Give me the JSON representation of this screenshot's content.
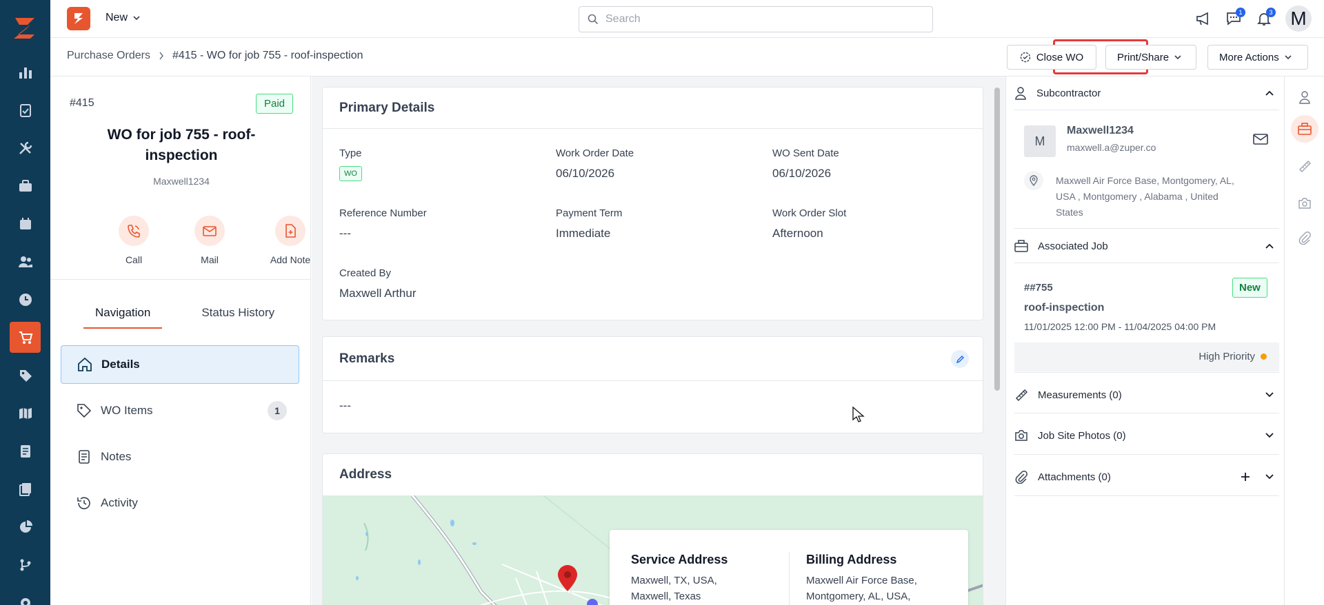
{
  "topbar": {
    "new_label": "New",
    "search_placeholder": "Search",
    "chat_badge": "1",
    "notif_badge": "3",
    "avatar_letter": "M"
  },
  "breadcrumb": {
    "root": "Purchase Orders",
    "current": "#415 - WO for job 755 - roof-inspection"
  },
  "actions": {
    "close_wo": "Close WO",
    "print_share": "Print/Share",
    "more_actions": "More Actions"
  },
  "wo": {
    "number": "#415",
    "status": "Paid",
    "title": "WO for job 755 - roof-inspection",
    "subtitle": "Maxwell1234",
    "quick_actions": [
      "Call",
      "Mail",
      "Add Note"
    ]
  },
  "tabs": [
    "Navigation",
    "Status History"
  ],
  "nav": [
    {
      "label": "Details",
      "icon": "home-icon"
    },
    {
      "label": "WO Items",
      "icon": "tag-icon",
      "count": "1"
    },
    {
      "label": "Notes",
      "icon": "note-icon"
    },
    {
      "label": "Activity",
      "icon": "history-icon"
    }
  ],
  "primary": {
    "title": "Primary Details",
    "type_label": "Type",
    "type_value": "WO",
    "wo_date_label": "Work Order Date",
    "wo_date_value": "06/10/2026",
    "sent_date_label": "WO Sent Date",
    "sent_date_value": "06/10/2026",
    "ref_label": "Reference Number",
    "ref_value": "---",
    "payment_label": "Payment Term",
    "payment_value": "Immediate",
    "slot_label": "Work Order Slot",
    "slot_value": "Afternoon",
    "created_label": "Created By",
    "created_value": "Maxwell Arthur"
  },
  "remarks": {
    "title": "Remarks",
    "value": "---"
  },
  "address": {
    "title": "Address",
    "service_title": "Service Address",
    "service_line1": "Maxwell, TX, USA,",
    "service_line2": "Maxwell, Texas",
    "billing_title": "Billing Address",
    "billing_line1": "Maxwell Air Force Base,",
    "billing_line2": "Montgomery, AL, USA,"
  },
  "right": {
    "subcontractor_title": "Subcontractor",
    "sub_initial": "M",
    "sub_name": "Maxwell1234",
    "sub_email": "maxwell.a@zuper.co",
    "sub_address_l1": "Maxwell Air Force Base, Montgomery, AL,",
    "sub_address_l2": "USA , Montgomery , Alabama , United",
    "sub_address_l3": "States",
    "job_title": "Associated Job",
    "job_number": "##755",
    "job_status": "New",
    "job_name": "roof-inspection",
    "job_dates": "11/01/2025 12:00 PM - 11/04/2025 04:00 PM",
    "job_priority": "High Priority",
    "measurements": "Measurements (0)",
    "photos": "Job Site Photos (0)",
    "attachments": "Attachments (0)"
  },
  "colors": {
    "sidebar": "#0f3b57",
    "accent": "#e8562f",
    "highlight_frame": "#e23b3b",
    "priority_dot": "#f59e0b"
  }
}
